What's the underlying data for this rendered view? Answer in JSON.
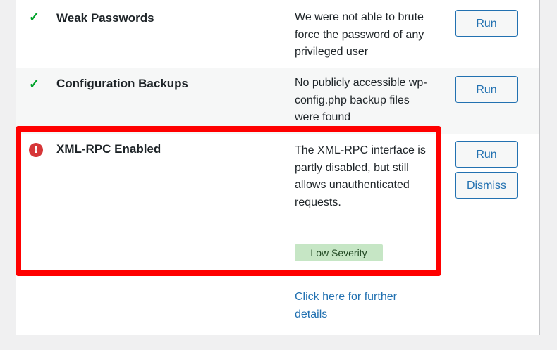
{
  "checks": [
    {
      "status": "pass",
      "status_glyph": "✓",
      "title": "Weak Passwords",
      "description": "We were not able to brute force the password of any privileged user",
      "run_label": "Run"
    },
    {
      "status": "pass",
      "status_glyph": "✓",
      "title": "Configuration Backups",
      "description": "No publicly accessible wp-config.php backup files were found",
      "run_label": "Run"
    },
    {
      "status": "fail",
      "status_glyph": "!",
      "title": "XML-RPC Enabled",
      "description": "The XML-RPC interface is partly disabled, but still allows unauthenticated requests.",
      "severity": "Low Severity",
      "run_label": "Run",
      "dismiss_label": "Dismiss",
      "details_link": "Click here for further details"
    }
  ],
  "colors": {
    "pass": "#00a32a",
    "fail": "#d63638",
    "accent": "#2271b1",
    "highlight": "#ff0000",
    "severity_bg": "#c6e6c5"
  },
  "icons": {
    "pass": "checkmark-icon",
    "fail": "alert-circle-icon"
  }
}
